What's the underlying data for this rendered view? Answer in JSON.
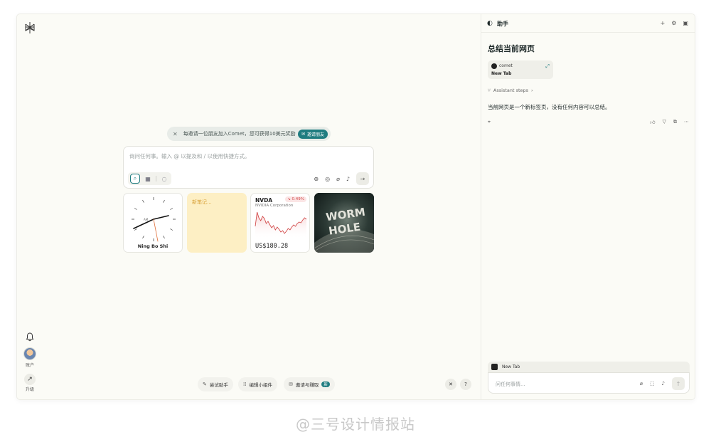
{
  "sidebar": {
    "account_label": "账户",
    "upgrade_label": "升级"
  },
  "banner": {
    "text": "每邀请一位朋友加入Comet，您可获得10美元奖励",
    "button_label": "邀请朋友"
  },
  "search": {
    "placeholder": "询问任何事。输入 @ 以提及和 / 以使用快捷方式。"
  },
  "widgets": {
    "clock": {
      "city": "Ning Bo Shi",
      "am_pm": "AM"
    },
    "note": {
      "text": "新笔记..."
    },
    "stock": {
      "symbol": "NVDA",
      "company": "NVIDIA Corporation",
      "change": "0.49%",
      "price": "US$180.28",
      "series": [
        42,
        22,
        30,
        34,
        28,
        31,
        38,
        35,
        40,
        44,
        41,
        47,
        43,
        46,
        50,
        48,
        52,
        49,
        45,
        47,
        43,
        40,
        42,
        38,
        36,
        37,
        33,
        30,
        32
      ]
    },
    "wormhole": {
      "line1": "WORM",
      "line2": "HOLE"
    }
  },
  "bottom": {
    "try_assistant": "尝试助手",
    "edit_widgets": "编辑小组件",
    "invite_earn": "邀请与赚取",
    "badge": "新"
  },
  "panel": {
    "title": "助手",
    "question": "总结当前网页",
    "source": {
      "name": "comet",
      "page": "New Tab"
    },
    "steps_label": "Assistant steps",
    "answer": "当前网页是一个新标签页，没有任何内容可以总结。",
    "context_tab": "New Tab",
    "ask_placeholder": "问任何事情..."
  },
  "watermark": "@三号设计情报站",
  "colors": {
    "accent": "#1f7c80",
    "background": "#fbfbf6",
    "note": "#fdefc4",
    "stock_down": "#d24a4a"
  }
}
